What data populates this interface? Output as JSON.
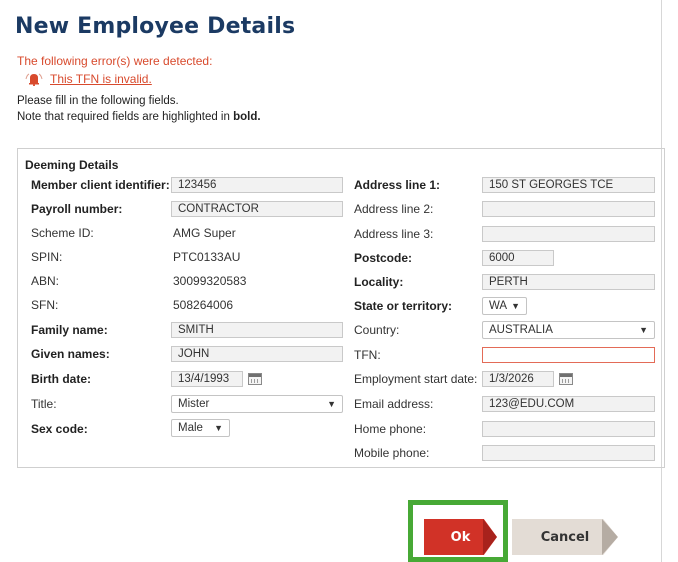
{
  "page": {
    "title": "New Employee Details",
    "error_heading": "The following error(s) were detected:",
    "errors": [
      "This TFN is invalid."
    ],
    "note_line1": "Please fill in the following fields.",
    "note_line2_prefix": "Note that required fields are highlighted in",
    "note_line2_bold": "bold."
  },
  "section": {
    "legend": "Deeming Details"
  },
  "left_fields": [
    {
      "label": "Member client identifier:",
      "value": "123456"
    },
    {
      "label": "Payroll number:",
      "value": "CONTRACTOR"
    },
    {
      "label": "Scheme ID:",
      "value": "AMG Super"
    },
    {
      "label": "SPIN:",
      "value": "PTC0133AU"
    },
    {
      "label": "ABN:",
      "value": "30099320583"
    },
    {
      "label": "SFN:",
      "value": "508264006"
    },
    {
      "label": "Family name:",
      "value": "SMITH"
    },
    {
      "label": "Given names:",
      "value": "JOHN"
    },
    {
      "label": "Birth date:",
      "value": "13/4/1993"
    },
    {
      "label": "Title:",
      "value": "Mister"
    },
    {
      "label": "Sex code:",
      "value": "Male"
    }
  ],
  "right_fields": [
    {
      "label": "Address line 1:",
      "value": "150 ST GEORGES TCE"
    },
    {
      "label": "Address line 2:",
      "value": ""
    },
    {
      "label": "Address line 3:",
      "value": ""
    },
    {
      "label": "Postcode:",
      "value": "6000"
    },
    {
      "label": "Locality:",
      "value": "PERTH"
    },
    {
      "label": "State or territory:",
      "value": "WA"
    },
    {
      "label": "Country:",
      "value": "AUSTRALIA"
    },
    {
      "label": "TFN:",
      "value": ""
    },
    {
      "label": "Employment start date:",
      "value": "1/3/2026"
    },
    {
      "label": "Email address:",
      "value": "123@EDU.COM"
    },
    {
      "label": "Home phone:",
      "value": ""
    },
    {
      "label": "Mobile phone:",
      "value": ""
    }
  ],
  "buttons": {
    "ok": "Ok",
    "cancel": "Cancel"
  },
  "colors": {
    "title": "#1b3a63",
    "error": "#d84a2d",
    "ok": "#d13227",
    "highlight": "#47a935"
  },
  "icons": {
    "error": "bell-icon",
    "calendar": "calendar-icon",
    "dropdown": "chevron-down-icon"
  }
}
